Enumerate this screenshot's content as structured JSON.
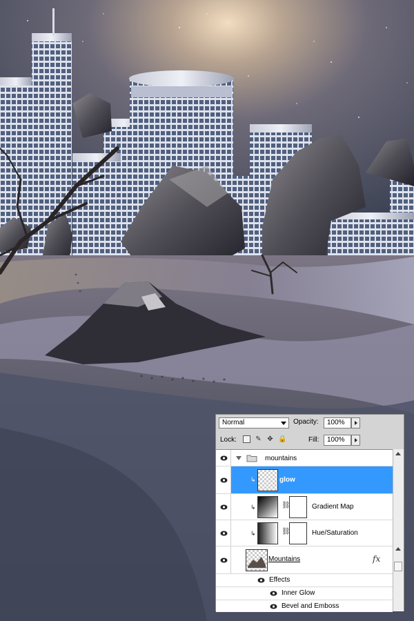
{
  "layers_panel": {
    "blend_mode": "Normal",
    "opacity_label": "Opacity:",
    "opacity_value": "100%",
    "lock_label": "Lock:",
    "fill_label": "Fill:",
    "fill_value": "100%",
    "rows": {
      "group": {
        "name": "mountains",
        "visible": true
      },
      "glow": {
        "name": "glow",
        "selected": true,
        "clipped": true
      },
      "gradient_map": {
        "name": "Gradient Map",
        "clipped": true
      },
      "hue_saturation": {
        "name": "Hue/Saturation",
        "clipped": true
      },
      "mountains_layer": {
        "name": "Mountains",
        "fx": "fx"
      },
      "effects": {
        "label": "Effects"
      },
      "effect_1": {
        "name": "Inner Glow"
      },
      "effect_2": {
        "name": "Bevel and Emboss"
      }
    }
  },
  "colors": {
    "selected_row": "#3399ff",
    "panel_bg": "#d4d4d4"
  }
}
